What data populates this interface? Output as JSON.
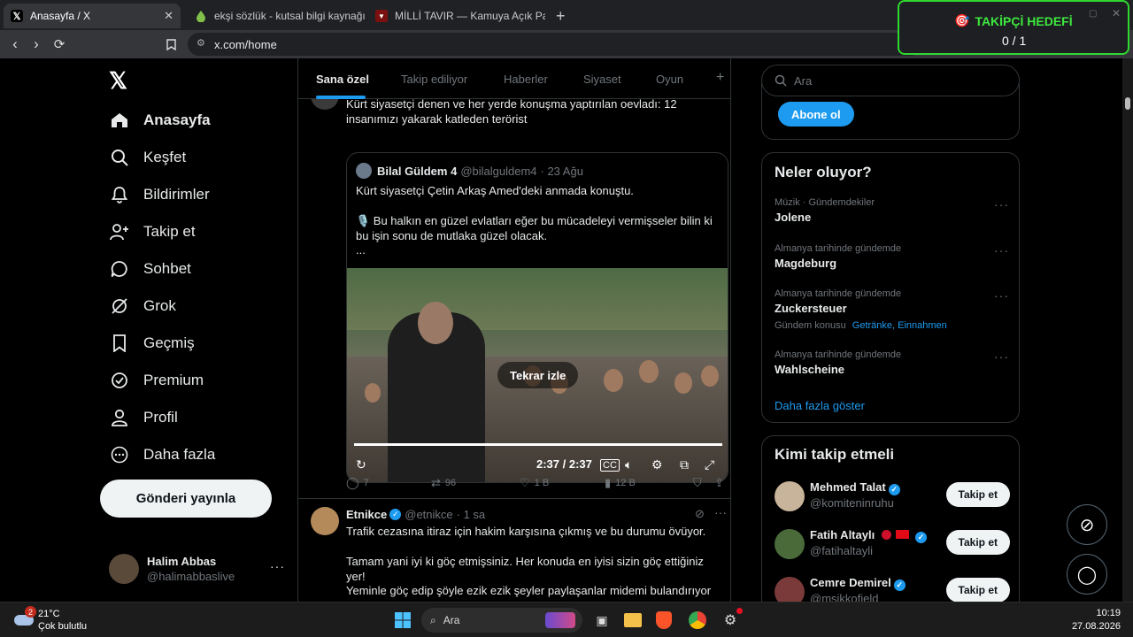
{
  "browser": {
    "tabs": [
      {
        "title": "Anasayfa / X",
        "active": true,
        "icon": "x-logo-icon"
      },
      {
        "title": "ekşi sözlük - kutsal bilgi kaynağı",
        "active": false,
        "icon": "eksi-drop-icon"
      },
      {
        "title": "MİLLİ TAVIR — Kamuya Açık Paylaşım",
        "active": false,
        "icon": "shield-icon"
      }
    ],
    "url": "x.com/home"
  },
  "widget": {
    "title": "TAKİPÇİ HEDEFİ",
    "progress": "0 / 1"
  },
  "leftnav": {
    "items": [
      {
        "label": "Anasayfa",
        "icon": "home-icon",
        "active": true
      },
      {
        "label": "Keşfet",
        "icon": "search-icon"
      },
      {
        "label": "Bildirimler",
        "icon": "bell-icon"
      },
      {
        "label": "Takip et",
        "icon": "person-plus-icon"
      },
      {
        "label": "Sohbet",
        "icon": "chat-icon"
      },
      {
        "label": "Grok",
        "icon": "grok-icon"
      },
      {
        "label": "Geçmiş",
        "icon": "bookmark-icon"
      },
      {
        "label": "Premium",
        "icon": "verified-badge-icon"
      },
      {
        "label": "Profil",
        "icon": "person-icon"
      },
      {
        "label": "Daha fazla",
        "icon": "more-circle-icon"
      }
    ],
    "post_button": "Gönderi yayınla",
    "account": {
      "name": "Halim Abbas",
      "handle": "@halimabbaslive"
    }
  },
  "hometabs": [
    "Sana özel",
    "Takip ediliyor",
    "Haberler",
    "Siyaset",
    "Oyun"
  ],
  "tweet1": {
    "text": "Kürt siyasetçi denen ve her yerde konuşma yaptırılan oevladı: 12 insanımızı yakarak katleden terörist",
    "quote": {
      "name": "Bilal Güldem 4",
      "handle": "@bilalguldem4",
      "date": "· 23 Ağu",
      "line1": "Kürt siyasetçi Çetin Arkaş Amed'deki anmada konuştu.",
      "line2": "🎙️ Bu halkın en güzel evlatları eğer bu mücadeleyi vermişseler bilin ki bu işin sonu de mutlaka güzel olacak.",
      "line3": "..."
    },
    "video": {
      "replay_label": "Tekrar izle",
      "time": "2:37 / 2:37",
      "progress": 1.0
    },
    "actions": {
      "replies": "7",
      "reposts": "96",
      "likes": "1 B",
      "views": "12 B"
    }
  },
  "tweet2": {
    "name": "Etnikce",
    "handle": "@etnikce",
    "time": "· 1 sa",
    "p1": "Trafik cezasına itiraz için hakim karşısına çıkmış ve bu durumu övüyor.",
    "p2": "Tamam yani iyi ki göç etmişsiniz. Her konuda en iyisi sizin göç ettiğiniz yer!",
    "p3": "Yeminle göç edip şöyle ezik ezik şeyler paylaşanlar midemi bulandırıyor"
  },
  "right": {
    "search_placeholder": "Ara",
    "subscribe": "Abone ol",
    "trends_title": "Neler oluyor?",
    "trends": [
      {
        "meta": "Müzik · Gündemdekiler",
        "name": "Jolene"
      },
      {
        "meta": "Almanya tarihinde gündemde",
        "name": "Magdeburg"
      },
      {
        "meta": "Almanya tarihinde gündemde",
        "name": "Zuckersteuer",
        "topic_label": "Gündem konusu",
        "topic_links": "Getränke, Einnahmen"
      },
      {
        "meta": "Almanya tarihinde gündemde",
        "name": "Wahlscheine"
      }
    ],
    "show_more": "Daha fazla göster",
    "who_title": "Kimi takip etmeli",
    "who": [
      {
        "name": "Mehmed Talat",
        "handle": "@komiteninruhu"
      },
      {
        "name": "Fatih Altaylı",
        "handle": "@fatihaltayli"
      },
      {
        "name": "Cemre Demirel",
        "handle": "@msikkofield"
      }
    ],
    "follow_label": "Takip et"
  },
  "taskbar": {
    "weather_temp": "21°C",
    "weather_desc": "Çok bulutlu",
    "weather_badge": "2",
    "search": "Ara",
    "time": "10:19",
    "date": "27.08.2026"
  },
  "colors": {
    "accent": "#1d9bf0",
    "widget_border": "#2ed82e",
    "widget_title": "#3ee83e"
  }
}
